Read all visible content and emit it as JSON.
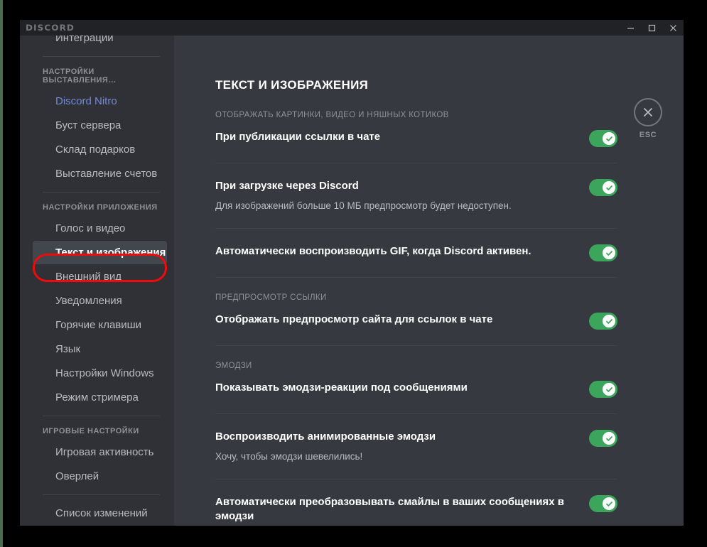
{
  "window": {
    "wordmark": "DISCORD",
    "controls": {
      "minimize": "minimize-icon",
      "maximize": "maximize-icon",
      "close": "close-icon"
    }
  },
  "sidebar": {
    "clipped_top_item": "Интеграции",
    "sections": [
      {
        "heading": "НАСТРОЙКИ ВЫСТАВЛЕНИЯ…",
        "items": [
          {
            "label": "Discord Nitro",
            "style": "nitro"
          },
          {
            "label": "Буст сервера",
            "style": "normal"
          },
          {
            "label": "Склад подарков",
            "style": "normal"
          },
          {
            "label": "Выставление счетов",
            "style": "normal"
          }
        ]
      },
      {
        "heading": "НАСТРОЙКИ ПРИЛОЖЕНИЯ",
        "items": [
          {
            "label": "Голос и видео",
            "style": "normal"
          },
          {
            "label": "Текст и изображения",
            "style": "active"
          },
          {
            "label": "Внешний вид",
            "style": "normal"
          },
          {
            "label": "Уведомления",
            "style": "normal"
          },
          {
            "label": "Горячие клавиши",
            "style": "normal"
          },
          {
            "label": "Язык",
            "style": "normal"
          },
          {
            "label": "Настройки Windows",
            "style": "normal"
          },
          {
            "label": "Режим стримера",
            "style": "normal"
          }
        ]
      },
      {
        "heading": "ИГРОВЫЕ НАСТРОЙКИ",
        "items": [
          {
            "label": "Игровая активность",
            "style": "normal"
          },
          {
            "label": "Оверлей",
            "style": "normal"
          }
        ]
      },
      {
        "heading": "",
        "items": [
          {
            "label": "Список изменений",
            "style": "normal"
          }
        ]
      }
    ],
    "highlight_color": "#f20a0a",
    "highlighted_item": "Текст и изображения"
  },
  "main": {
    "title": "ТЕКСТ И ИЗОБРАЖЕНИЯ",
    "group_media_label": "ОТОБРАЖАТЬ КАРТИНКИ, ВИДЕО И НЯШНЫХ КОТИКОВ",
    "group_linkpreview_label": "ПРЕДПРОСМОТР ССЫЛКИ",
    "group_emoji_label": "ЭМОДЗИ",
    "rows": [
      {
        "title": "При публикации ссылки в чате",
        "desc": "",
        "toggle": "on"
      },
      {
        "title": "При загрузке через Discord",
        "desc": "Для изображений больше 10 МБ предпросмотр будет недоступен.",
        "toggle": "on"
      },
      {
        "title": "Автоматически воспроизводить GIF, когда Discord активен.",
        "desc": "",
        "toggle": "on"
      },
      {
        "title": "Отображать предпросмотр сайта для ссылок в чате",
        "desc": "",
        "toggle": "on"
      },
      {
        "title": "Показывать эмодзи-реакции под сообщениями",
        "desc": "",
        "toggle": "on"
      },
      {
        "title": "Воспроизводить анимированные эмодзи",
        "desc": "Хочу, чтобы эмодзи шевелились!",
        "toggle": "on"
      },
      {
        "title": "Автоматически преобразовывать смайлы в ваших сообщениях в эмодзи",
        "desc": "",
        "toggle": "on"
      }
    ]
  },
  "close": {
    "icon": "close-icon",
    "label": "ESC"
  },
  "colors": {
    "toggle_on": "#3ba55c",
    "nitro_link": "#7289da",
    "sidebar_bg": "#2f3136",
    "content_bg": "#36393f",
    "titlebar_bg": "#202225"
  }
}
